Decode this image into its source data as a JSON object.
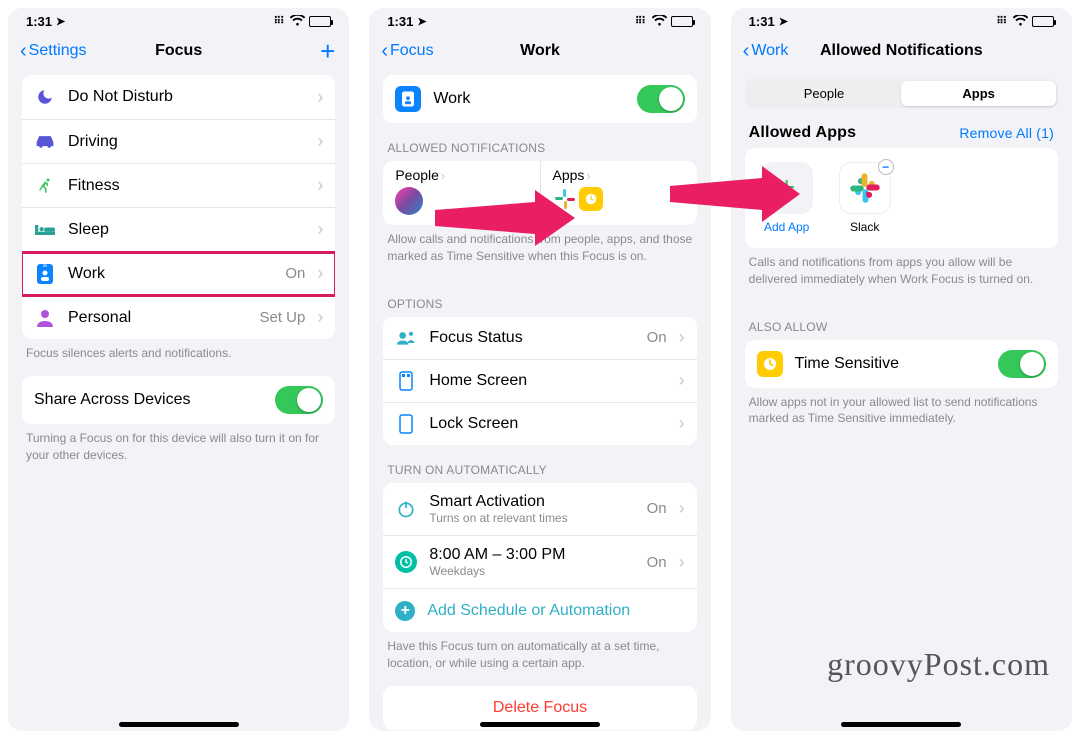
{
  "status": {
    "time": "1:31",
    "location_arrow": "➤"
  },
  "screen1": {
    "back": "Settings",
    "title": "Focus",
    "items": [
      {
        "icon": "moon",
        "label": "Do Not Disturb",
        "value": ""
      },
      {
        "icon": "car",
        "label": "Driving",
        "value": ""
      },
      {
        "icon": "runner",
        "label": "Fitness",
        "value": ""
      },
      {
        "icon": "bed",
        "label": "Sleep",
        "value": ""
      },
      {
        "icon": "badge",
        "label": "Work",
        "value": "On"
      },
      {
        "icon": "person",
        "label": "Personal",
        "value": "Set Up"
      }
    ],
    "footer1": "Focus silences alerts and notifications.",
    "share_label": "Share Across Devices",
    "footer2": "Turning a Focus on for this device will also turn it on for your other devices."
  },
  "screen2": {
    "back": "Focus",
    "title": "Work",
    "work_label": "Work",
    "sect_allowed": "ALLOWED NOTIFICATIONS",
    "people_label": "People",
    "apps_label": "Apps",
    "allowed_footer": "Allow calls and notifications from people, apps, and those marked as Time Sensitive when this Focus is on.",
    "sect_options": "OPTIONS",
    "opt_focus_status": "Focus Status",
    "opt_focus_status_val": "On",
    "opt_home": "Home Screen",
    "opt_lock": "Lock Screen",
    "sect_auto": "TURN ON AUTOMATICALLY",
    "smart_label": "Smart Activation",
    "smart_sub": "Turns on at relevant times",
    "smart_val": "On",
    "time_label": "8:00 AM – 3:00 PM",
    "time_sub": "Weekdays",
    "time_val": "On",
    "add_auto": "Add Schedule or Automation",
    "auto_footer": "Have this Focus turn on automatically at a set time, location, or while using a certain app.",
    "delete": "Delete Focus"
  },
  "screen3": {
    "back": "Work",
    "title": "Allowed Notifications",
    "seg_people": "People",
    "seg_apps": "Apps",
    "allowed_header": "Allowed Apps",
    "remove_all": "Remove All (1)",
    "add_app": "Add App",
    "app_name": "Slack",
    "apps_footer": "Calls and notifications from apps you allow will be delivered immediately when Work Focus is turned on.",
    "also_allow": "ALSO ALLOW",
    "ts_label": "Time Sensitive",
    "ts_footer": "Allow apps not in your allowed list to send notifications marked as Time Sensitive immediately."
  },
  "watermark": "groovyPost.com"
}
